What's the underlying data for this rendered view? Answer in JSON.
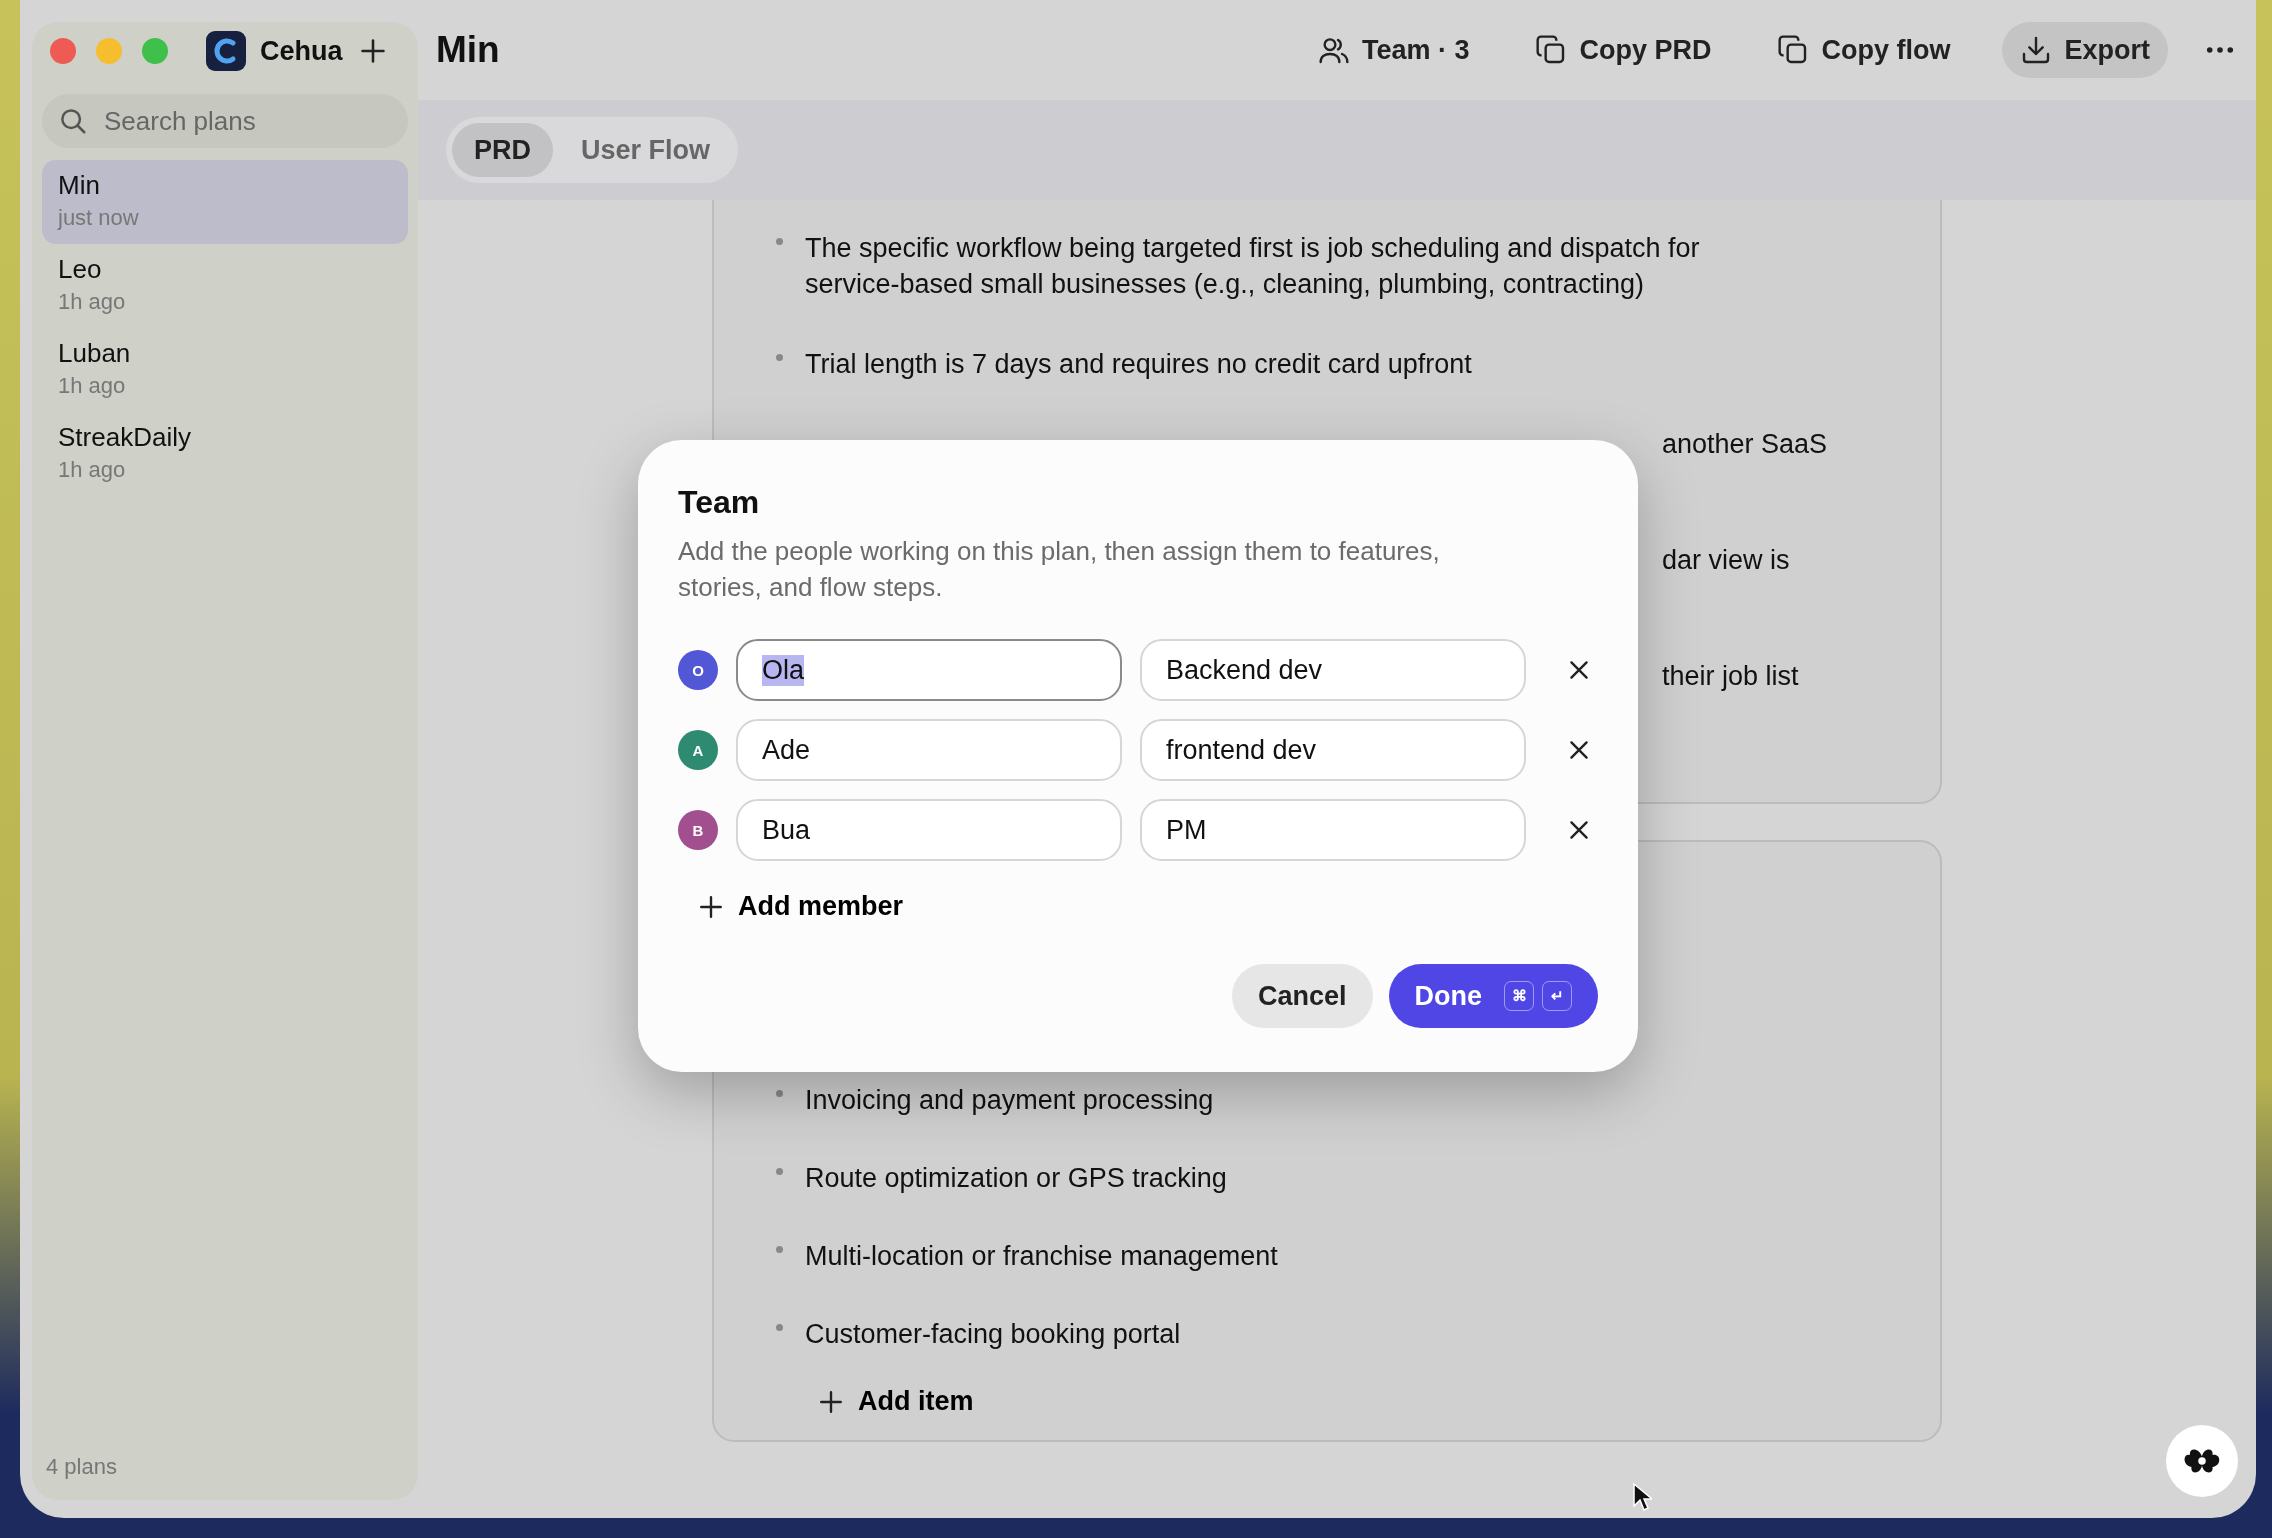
{
  "app": {
    "name": "Cehua"
  },
  "sidebar": {
    "search": {
      "placeholder": "Search plans"
    },
    "items": [
      {
        "title": "Min",
        "time": "just now",
        "selected": true
      },
      {
        "title": "Leo",
        "time": "1h ago",
        "selected": false
      },
      {
        "title": "Luban",
        "time": "1h ago",
        "selected": false
      },
      {
        "title": "StreakDaily",
        "time": "1h ago",
        "selected": false
      }
    ],
    "footer": "4 plans"
  },
  "header": {
    "title": "Min",
    "actions": [
      {
        "kind": "team",
        "label": "Team · 3",
        "highlighted": false
      },
      {
        "kind": "copy",
        "label": "Copy PRD",
        "highlighted": false
      },
      {
        "kind": "copy",
        "label": "Copy flow",
        "highlighted": false
      },
      {
        "kind": "export",
        "label": "Export",
        "highlighted": true
      }
    ]
  },
  "tabs": [
    {
      "label": "PRD",
      "selected": true
    },
    {
      "label": "User Flow",
      "selected": false
    }
  ],
  "cards": [
    {
      "items": [
        {
          "kind": "full",
          "text": "The specific workflow being targeted first is job scheduling and dispatch for service-based small businesses (e.g., cleaning, plumbing, contracting)"
        },
        {
          "kind": "full",
          "text": "Trial length is 7 days and requires no credit card upfront"
        },
        {
          "kind": "partial",
          "text": "another SaaS"
        },
        {
          "kind": "partial",
          "text": "dar view is"
        },
        {
          "kind": "partial",
          "text": "their job list"
        }
      ]
    },
    {
      "items": [
        {
          "kind": "full",
          "text": "Invoicing and payment processing"
        },
        {
          "kind": "full",
          "text": "Route optimization or GPS tracking"
        },
        {
          "kind": "full",
          "text": "Multi-location or franchise management"
        },
        {
          "kind": "full",
          "text": "Customer-facing booking portal"
        }
      ],
      "add_label": "Add item"
    }
  ],
  "dialog": {
    "title": "Team",
    "description": "Add the people working on this plan, then assign them to features, stories, and flow steps.",
    "members": [
      {
        "initial": "O",
        "color": "#5257d6",
        "name": "Ola",
        "role": "Backend dev",
        "focused": true
      },
      {
        "initial": "A",
        "color": "#2f8a72",
        "name": "Ade",
        "role": "frontend dev",
        "focused": false
      },
      {
        "initial": "B",
        "color": "#a14f8f",
        "name": "Bua",
        "role": "PM",
        "focused": false
      }
    ],
    "add_label": "Add member",
    "cancel": "Cancel",
    "done": "Done",
    "shortcut": [
      "⌘",
      "↵"
    ]
  }
}
